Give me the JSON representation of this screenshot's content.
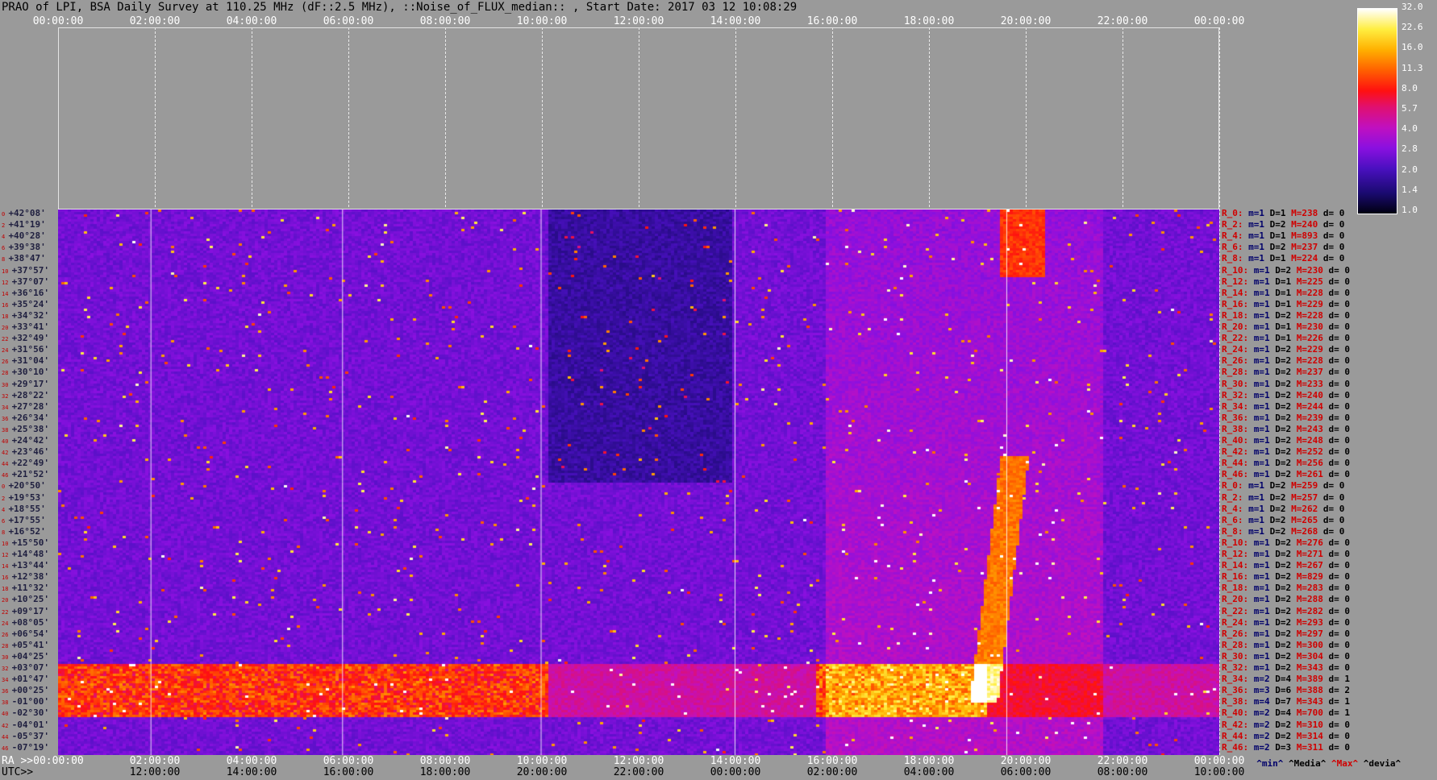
{
  "title": "PRAO of LPI, BSA Daily Survey at 110.25 MHz (dF::2.5 MHz), ::Noise_of_FLUX_median:: , Start Date: 2017 03 12 10:08:29",
  "top_ticks": [
    "00:00:00",
    "02:00:00",
    "04:00:00",
    "06:00:00",
    "08:00:00",
    "10:00:00",
    "12:00:00",
    "14:00:00",
    "16:00:00",
    "18:00:00",
    "20:00:00",
    "22:00:00",
    "00:00:00"
  ],
  "bottom_ra_ticks": [
    "02:00:00",
    "04:00:00",
    "06:00:00",
    "08:00:00",
    "10:00:00",
    "12:00:00",
    "14:00:00",
    "16:00:00",
    "18:00:00",
    "20:00:00",
    "22:00:00",
    "00:00:00"
  ],
  "bottom_utc_ticks": [
    "12:00:00",
    "14:00:00",
    "16:00:00",
    "18:00:00",
    "20:00:00",
    "22:00:00",
    "00:00:00",
    "02:00:00",
    "04:00:00",
    "06:00:00",
    "08:00:00",
    "10:00:00"
  ],
  "ra_label": "RA >>00:00:00",
  "utc_label": "UTC>>",
  "declinations": [
    "+42°08'",
    "+41°19'",
    "+40°28'",
    "+39°38'",
    "+38°47'",
    "+37°57'",
    "+37°07'",
    "+36°16'",
    "+35°24'",
    "+34°32'",
    "+33°41'",
    "+32°49'",
    "+31°56'",
    "+31°04'",
    "+30°10'",
    "+29°17'",
    "+28°22'",
    "+27°28'",
    "+26°34'",
    "+25°38'",
    "+24°42'",
    "+23°46'",
    "+22°49'",
    "+21°52'",
    "+20°50'",
    "+19°53'",
    "+18°55'",
    "+17°55'",
    "+16°52'",
    "+15°50'",
    "+14°48'",
    "+13°44'",
    "+12°38'",
    "+11°32'",
    "+10°25'",
    "+09°17'",
    "+08°05'",
    "+06°54'",
    "+05°41'",
    "+04°25'",
    "+03°07'",
    "+01°47'",
    "+00°25'",
    "-01°00'",
    "-02°30'",
    "-04°01'",
    "-05°37'",
    "-07°19'"
  ],
  "dec_indices": [
    "0",
    "2",
    "4",
    "6",
    "8",
    "10",
    "12",
    "14",
    "16",
    "18",
    "20",
    "22",
    "24",
    "26",
    "28",
    "30",
    "32",
    "34",
    "36",
    "38",
    "40",
    "42",
    "44",
    "46",
    "0",
    "2",
    "4",
    "6",
    "8",
    "10",
    "12",
    "14",
    "16",
    "18",
    "20",
    "22",
    "24",
    "26",
    "28",
    "30",
    "32",
    "34",
    "36",
    "38",
    "40",
    "42",
    "44",
    "46"
  ],
  "right_stats": [
    {
      "r": "R_0:",
      "m": "m=1",
      "d": "D=1",
      "M": "M=238",
      "dev": "d= 0"
    },
    {
      "r": "R_2:",
      "m": "m=1",
      "d": "D=2",
      "M": "M=240",
      "dev": "d= 0"
    },
    {
      "r": "R_4:",
      "m": "m=1",
      "d": "D=1",
      "M": "M=893",
      "dev": "d= 0"
    },
    {
      "r": "R_6:",
      "m": "m=1",
      "d": "D=2",
      "M": "M=237",
      "dev": "d= 0"
    },
    {
      "r": "R_8:",
      "m": "m=1",
      "d": "D=1",
      "M": "M=224",
      "dev": "d= 0"
    },
    {
      "r": "R_10:",
      "m": "m=1",
      "d": "D=2",
      "M": "M=230",
      "dev": "d= 0"
    },
    {
      "r": "R_12:",
      "m": "m=1",
      "d": "D=1",
      "M": "M=225",
      "dev": "d= 0"
    },
    {
      "r": "R_14:",
      "m": "m=1",
      "d": "D=1",
      "M": "M=228",
      "dev": "d= 0"
    },
    {
      "r": "R_16:",
      "m": "m=1",
      "d": "D=1",
      "M": "M=229",
      "dev": "d= 0"
    },
    {
      "r": "R_18:",
      "m": "m=1",
      "d": "D=2",
      "M": "M=228",
      "dev": "d= 0"
    },
    {
      "r": "R_20:",
      "m": "m=1",
      "d": "D=1",
      "M": "M=230",
      "dev": "d= 0"
    },
    {
      "r": "R_22:",
      "m": "m=1",
      "d": "D=1",
      "M": "M=226",
      "dev": "d= 0"
    },
    {
      "r": "R_24:",
      "m": "m=1",
      "d": "D=2",
      "M": "M=229",
      "dev": "d= 0"
    },
    {
      "r": "R_26:",
      "m": "m=1",
      "d": "D=2",
      "M": "M=228",
      "dev": "d= 0"
    },
    {
      "r": "R_28:",
      "m": "m=1",
      "d": "D=2",
      "M": "M=237",
      "dev": "d= 0"
    },
    {
      "r": "R_30:",
      "m": "m=1",
      "d": "D=2",
      "M": "M=233",
      "dev": "d= 0"
    },
    {
      "r": "R_32:",
      "m": "m=1",
      "d": "D=2",
      "M": "M=240",
      "dev": "d= 0"
    },
    {
      "r": "R_34:",
      "m": "m=1",
      "d": "D=2",
      "M": "M=244",
      "dev": "d= 0"
    },
    {
      "r": "R_36:",
      "m": "m=1",
      "d": "D=2",
      "M": "M=239",
      "dev": "d= 0"
    },
    {
      "r": "R_38:",
      "m": "m=1",
      "d": "D=2",
      "M": "M=243",
      "dev": "d= 0"
    },
    {
      "r": "R_40:",
      "m": "m=1",
      "d": "D=2",
      "M": "M=248",
      "dev": "d= 0"
    },
    {
      "r": "R_42:",
      "m": "m=1",
      "d": "D=2",
      "M": "M=252",
      "dev": "d= 0"
    },
    {
      "r": "R_44:",
      "m": "m=1",
      "d": "D=2",
      "M": "M=256",
      "dev": "d= 0"
    },
    {
      "r": "R_46:",
      "m": "m=1",
      "d": "D=2",
      "M": "M=261",
      "dev": "d= 0"
    },
    {
      "r": "R_0:",
      "m": "m=1",
      "d": "D=2",
      "M": "M=259",
      "dev": "d= 0"
    },
    {
      "r": "R_2:",
      "m": "m=1",
      "d": "D=2",
      "M": "M=257",
      "dev": "d= 0"
    },
    {
      "r": "R_4:",
      "m": "m=1",
      "d": "D=2",
      "M": "M=262",
      "dev": "d= 0"
    },
    {
      "r": "R_6:",
      "m": "m=1",
      "d": "D=2",
      "M": "M=265",
      "dev": "d= 0"
    },
    {
      "r": "R_8:",
      "m": "m=1",
      "d": "D=2",
      "M": "M=268",
      "dev": "d= 0"
    },
    {
      "r": "R_10:",
      "m": "m=1",
      "d": "D=2",
      "M": "M=276",
      "dev": "d= 0"
    },
    {
      "r": "R_12:",
      "m": "m=1",
      "d": "D=2",
      "M": "M=271",
      "dev": "d= 0"
    },
    {
      "r": "R_14:",
      "m": "m=1",
      "d": "D=2",
      "M": "M=267",
      "dev": "d= 0"
    },
    {
      "r": "R_16:",
      "m": "m=1",
      "d": "D=2",
      "M": "M=829",
      "dev": "d= 0"
    },
    {
      "r": "R_18:",
      "m": "m=1",
      "d": "D=2",
      "M": "M=283",
      "dev": "d= 0"
    },
    {
      "r": "R_20:",
      "m": "m=1",
      "d": "D=2",
      "M": "M=288",
      "dev": "d= 0"
    },
    {
      "r": "R_22:",
      "m": "m=1",
      "d": "D=2",
      "M": "M=282",
      "dev": "d= 0"
    },
    {
      "r": "R_24:",
      "m": "m=1",
      "d": "D=2",
      "M": "M=293",
      "dev": "d= 0"
    },
    {
      "r": "R_26:",
      "m": "m=1",
      "d": "D=2",
      "M": "M=297",
      "dev": "d= 0"
    },
    {
      "r": "R_28:",
      "m": "m=1",
      "d": "D=2",
      "M": "M=300",
      "dev": "d= 0"
    },
    {
      "r": "R_30:",
      "m": "m=1",
      "d": "D=2",
      "M": "M=304",
      "dev": "d= 0"
    },
    {
      "r": "R_32:",
      "m": "m=1",
      "d": "D=2",
      "M": "M=343",
      "dev": "d= 0"
    },
    {
      "r": "R_34:",
      "m": "m=2",
      "d": "D=4",
      "M": "M=389",
      "dev": "d= 1"
    },
    {
      "r": "R_36:",
      "m": "m=3",
      "d": "D=6",
      "M": "M=388",
      "dev": "d= 2"
    },
    {
      "r": "R_38:",
      "m": "m=4",
      "d": "D=7",
      "M": "M=343",
      "dev": "d= 1"
    },
    {
      "r": "R_40:",
      "m": "m=2",
      "d": "D=4",
      "M": "M=700",
      "dev": "d= 1"
    },
    {
      "r": "R_42:",
      "m": "m=2",
      "d": "D=2",
      "M": "M=310",
      "dev": "d= 0"
    },
    {
      "r": "R_44:",
      "m": "m=2",
      "d": "D=2",
      "M": "M=314",
      "dev": "d= 0"
    },
    {
      "r": "R_46:",
      "m": "m=2",
      "d": "D=3",
      "M": "M=311",
      "dev": "d= 0"
    }
  ],
  "stat_legend": {
    "min": "^min^",
    "media": "^Media^",
    "max": "^Max^",
    "devia": "^devia^"
  },
  "colorbar": {
    "labels": [
      "32.0",
      "22.6",
      "16.0",
      "11.3",
      "8.0",
      "5.7",
      "4.0",
      "2.8",
      "2.0",
      "1.4",
      "1.0"
    ]
  },
  "chart_data": {
    "type": "heatmap",
    "title": "PRAO of LPI, BSA Daily Survey at 110.25 MHz (dF::2.5 MHz), ::Noise_of_FLUX_median:: , Start Date: 2017 03 12 10:08:29",
    "x_axis_ra": [
      "00:00:00",
      "02:00:00",
      "04:00:00",
      "06:00:00",
      "08:00:00",
      "10:00:00",
      "12:00:00",
      "14:00:00",
      "16:00:00",
      "18:00:00",
      "20:00:00",
      "22:00:00",
      "00:00:00"
    ],
    "x_axis_utc": [
      "12:00:00",
      "14:00:00",
      "16:00:00",
      "18:00:00",
      "20:00:00",
      "22:00:00",
      "00:00:00",
      "02:00:00",
      "04:00:00",
      "06:00:00",
      "08:00:00",
      "10:00:00"
    ],
    "y_axis": "declination beams (48 rows, +42°08' to -07°19')",
    "colorscale_range": [
      1.0,
      32.0
    ],
    "colorscale": "log"
  }
}
